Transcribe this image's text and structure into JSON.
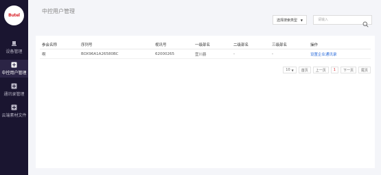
{
  "sidebar": {
    "logo_text": "Butel",
    "items": [
      {
        "label": "设备管理",
        "icon": "device-icon"
      },
      {
        "label": "中控用户管理",
        "icon": "plus-square-icon"
      },
      {
        "label": "通讯录管理",
        "icon": "plus-square-icon"
      },
      {
        "label": "云端素材文件",
        "icon": "plus-square-icon"
      }
    ]
  },
  "header": {
    "title": "中控用户管理"
  },
  "search": {
    "type_label": "选择搜索类型",
    "placeholder": "请输入"
  },
  "table": {
    "columns": [
      "参会名称",
      "序列号",
      "视讯号",
      "一级部名",
      "二级部名",
      "三级部名",
      "操作"
    ],
    "rows": [
      [
        "啊",
        "BOX96A1A26580BC",
        "62000265",
        "宜川县",
        "-",
        "-",
        "设置企业通讯录"
      ]
    ]
  },
  "pagination": {
    "page_size": "10",
    "first": "首页",
    "prev": "上一页",
    "current": "1",
    "next": "下一页",
    "last": "尾页"
  },
  "colors": {
    "sidebar_bg": "#1a1530",
    "link": "#2c6ddb",
    "current_page": "#d8232a"
  }
}
